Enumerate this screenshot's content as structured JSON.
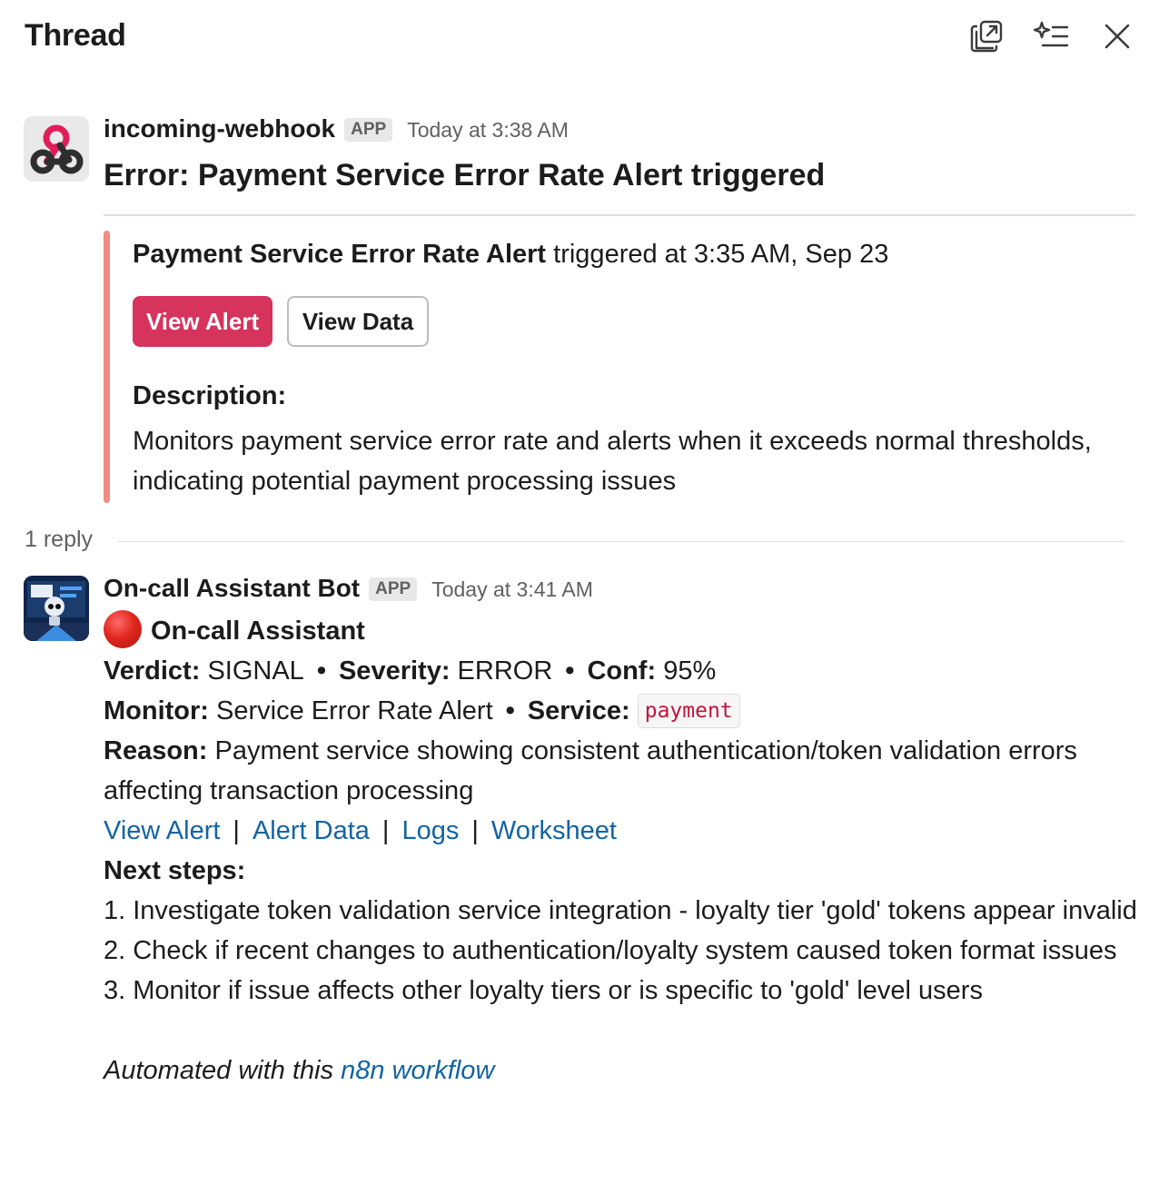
{
  "header": {
    "title": "Thread"
  },
  "root_message": {
    "sender": "incoming-webhook",
    "badge": "APP",
    "timestamp": "Today at 3:38 AM",
    "title": "Error: Payment Service Error Rate Alert triggered",
    "attachment": {
      "accent_color": "#f28b82",
      "alert_name": "Payment Service Error Rate Alert",
      "triggered_text": " triggered at 3:35 AM, Sep 23",
      "buttons": {
        "primary": "View Alert",
        "secondary": "View Data"
      },
      "description_label": "Description:",
      "description": "Monitors payment service error rate and alerts when it exceeds normal thresholds, indicating potential payment processing issues"
    }
  },
  "replies": {
    "count_label": "1 reply"
  },
  "bot_message": {
    "sender": "On-call Assistant Bot",
    "badge": "APP",
    "timestamp": "Today at 3:41 AM",
    "heading": "On-call Assistant",
    "verdict_label": "Verdict:",
    "verdict": "SIGNAL",
    "severity_label": "Severity:",
    "severity": "ERROR",
    "conf_label": "Conf:",
    "conf": "95%",
    "bullet": "•",
    "monitor_label": "Monitor:",
    "monitor": "Service Error Rate Alert",
    "service_label": "Service:",
    "service": "payment",
    "reason_label": "Reason:",
    "reason": "Payment service showing consistent authentication/token validation errors affecting transaction processing",
    "links": [
      "View Alert",
      "Alert Data",
      "Logs",
      "Worksheet"
    ],
    "pipe": "|",
    "next_steps_label": "Next steps:",
    "steps": [
      "1. Investigate token validation service integration - loyalty tier 'gold' tokens appear invalid",
      "2. Check if recent changes to authentication/loyalty system caused token format issues",
      "3. Monitor if issue affects other loyalty tiers or is specific to 'gold' level users"
    ],
    "footer_prefix": "Automated with this ",
    "footer_link": "n8n workflow"
  },
  "colors": {
    "primary_button": "#d6335d",
    "link": "#1264a3",
    "code_text": "#c0143c"
  }
}
